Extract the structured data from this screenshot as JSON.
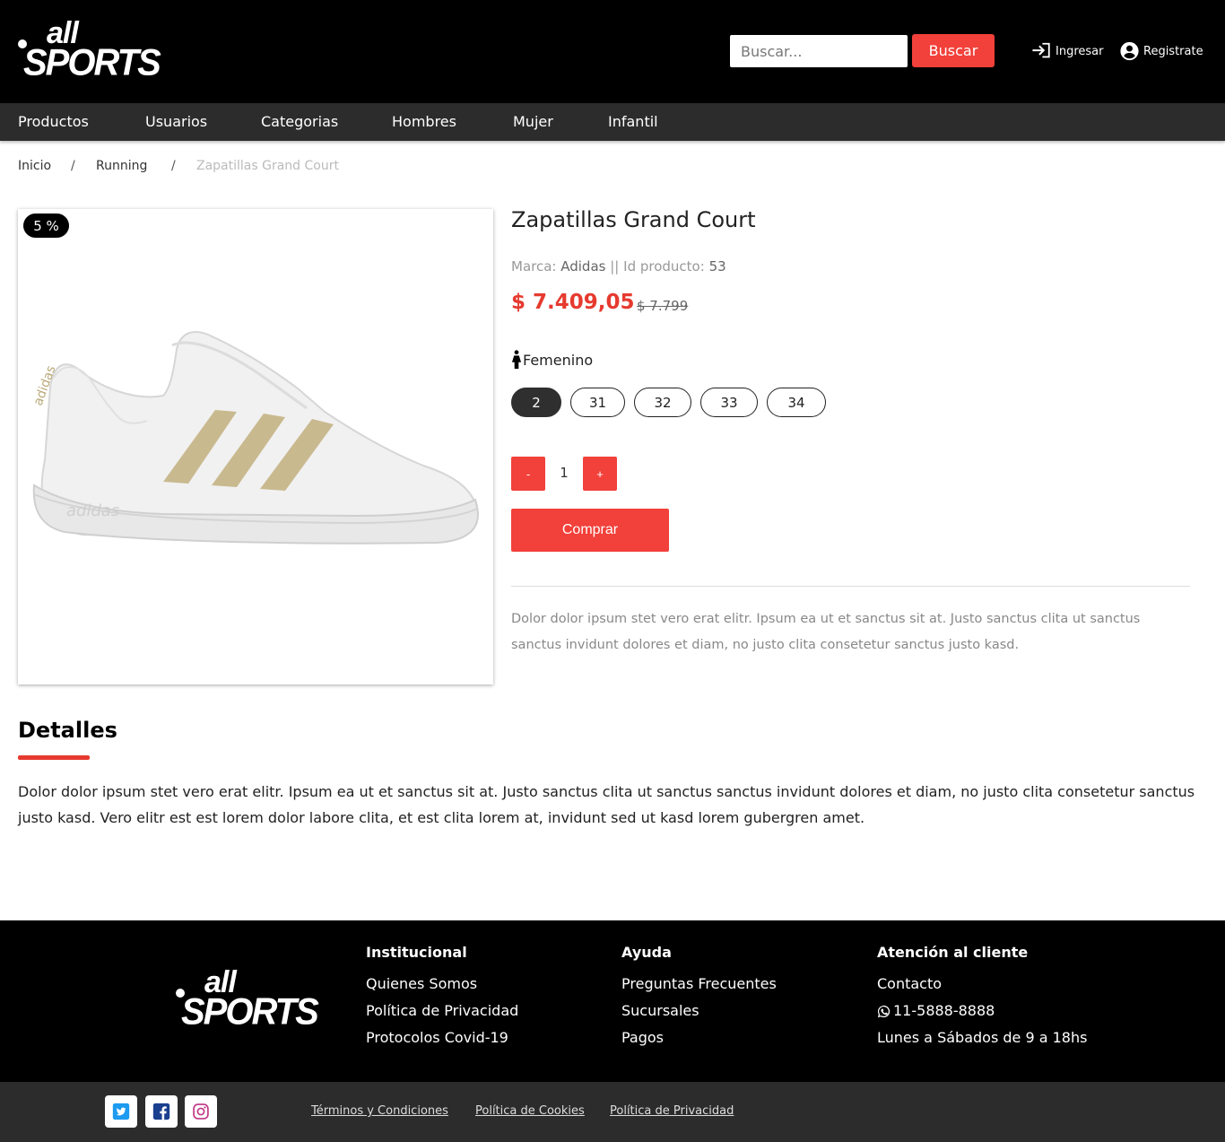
{
  "brand": {
    "logo_line1": "all",
    "logo_line2": "SPORTS"
  },
  "header": {
    "search_placeholder": "Buscar...",
    "search_button": "Buscar",
    "login": "Ingresar",
    "register": "Registrate"
  },
  "nav": [
    "Productos",
    "Usuarios",
    "Categorias",
    "Hombres",
    "Mujer",
    "Infantil"
  ],
  "breadcrumb": {
    "home": "Inicio",
    "category": "Running",
    "current": "Zapatillas Grand Court",
    "separator": "/"
  },
  "product": {
    "discount_badge": "5 %",
    "title": "Zapatillas Grand Court",
    "brand_label": "Marca:",
    "brand": "Adidas",
    "meta_sep": "||",
    "id_label": "Id producto:",
    "id": "53",
    "price": "$ 7.409,05",
    "old_price": "$ 7.799",
    "gender": "Femenino",
    "sizes": [
      "2",
      "31",
      "32",
      "33",
      "34"
    ],
    "selected_size": "2",
    "qty_minus": "-",
    "qty": "1",
    "qty_plus": "+",
    "buy_button": "Comprar",
    "description": "Dolor dolor ipsum stet vero erat elitr. Ipsum ea ut et sanctus sit at. Justo sanctus clita ut sanctus sanctus invidunt dolores et diam, no justo clita consetetur sanctus justo kasd."
  },
  "details": {
    "title": "Detalles",
    "text": "Dolor dolor ipsum stet vero erat elitr. Ipsum ea ut et sanctus sit at. Justo sanctus clita ut sanctus sanctus invidunt dolores et diam, no justo clita consetetur sanctus justo kasd. Vero elitr est est lorem dolor labore clita, et est clita lorem at, invidunt sed ut kasd lorem gubergren amet."
  },
  "footer": {
    "institucional": {
      "title": "Institucional",
      "links": [
        "Quienes Somos",
        "Política de Privacidad",
        "Protocolos Covid-19"
      ]
    },
    "ayuda": {
      "title": "Ayuda",
      "links": [
        "Preguntas Frecuentes",
        "Sucursales",
        "Pagos"
      ]
    },
    "atencion": {
      "title": "Atención al cliente",
      "contact": "Contacto",
      "phone": "11-5888-8888",
      "hours": "Lunes a Sábados de 9 a 18hs"
    },
    "legal": [
      "Términos y Condiciones",
      "Política de Cookies",
      "Política de Privacidad"
    ],
    "social": [
      "twitter-icon",
      "facebook-icon",
      "instagram-icon"
    ]
  },
  "colors": {
    "accent": "#f2403a",
    "price": "#e63a2f",
    "header_bg": "#000000",
    "nav_bg": "#2c2c2c"
  }
}
